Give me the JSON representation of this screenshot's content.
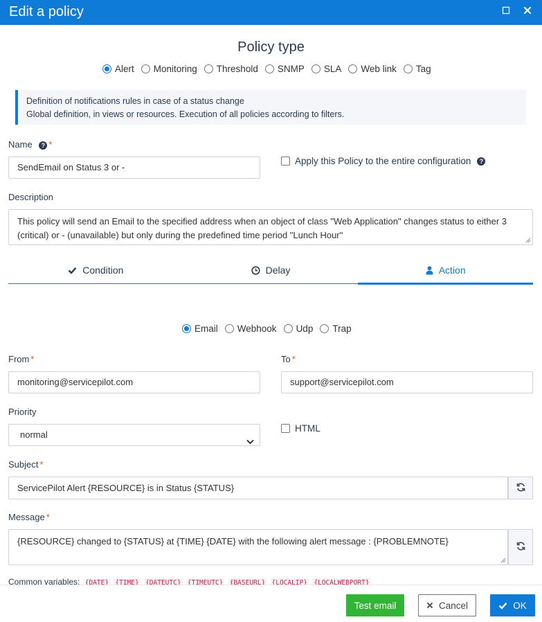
{
  "dialog": {
    "title": "Edit a policy"
  },
  "policy_type": {
    "heading": "Policy type",
    "options": [
      {
        "label": "Alert",
        "checked": true
      },
      {
        "label": "Monitoring",
        "checked": false
      },
      {
        "label": "Threshold",
        "checked": false
      },
      {
        "label": "SNMP",
        "checked": false
      },
      {
        "label": "SLA",
        "checked": false
      },
      {
        "label": "Web link",
        "checked": false
      },
      {
        "label": "Tag",
        "checked": false
      }
    ]
  },
  "info": {
    "line1": "Definition of notifications rules in case of a status change",
    "line2": "Global definition, in views or resources. Execution of all policies according to filters."
  },
  "name": {
    "label": "Name",
    "required": "*",
    "help": "?",
    "value": "SendEmail on Status 3 or -"
  },
  "apply_all": {
    "label": "Apply this Policy to the entire configuration",
    "help": "?",
    "checked": false
  },
  "description": {
    "label": "Description",
    "value": "This policy will send an Email to the specified address when an object of class \"Web Application\" changes status to either 3 (critical) or - (unavailable) but only during the predefined time period \"Lunch Hour\""
  },
  "tabs": [
    {
      "label": "Condition",
      "icon": "check-icon",
      "active": false
    },
    {
      "label": "Delay",
      "icon": "clock-icon",
      "active": false
    },
    {
      "label": "Action",
      "icon": "user-icon",
      "active": true
    }
  ],
  "action_type": {
    "options": [
      {
        "label": "Email",
        "checked": true
      },
      {
        "label": "Webhook",
        "checked": false
      },
      {
        "label": "Udp",
        "checked": false
      },
      {
        "label": "Trap",
        "checked": false
      }
    ]
  },
  "from": {
    "label": "From",
    "required": "*",
    "value": "monitoring@servicepilot.com"
  },
  "to": {
    "label": "To",
    "required": "*",
    "value": "support@servicepilot.com"
  },
  "priority": {
    "label": "Priority",
    "value": "normal"
  },
  "html": {
    "label": "HTML",
    "checked": false
  },
  "subject": {
    "label": "Subject",
    "required": "*",
    "value": "ServicePilot Alert {RESOURCE} is in Status {STATUS}"
  },
  "message": {
    "label": "Message",
    "required": "*",
    "value": "{RESOURCE} changed to {STATUS} at {TIME} {DATE} with the following alert message : {PROBLEMNOTE}"
  },
  "common_variables": {
    "label": "Common variables:",
    "items": [
      "{DATE}",
      "{TIME}",
      "{DATEUTC}",
      "{TIMEUTC}",
      "{BASEURL}",
      "{LOCALIP}",
      "{LOCALWEBPORT}"
    ]
  },
  "footer": {
    "test_label": "Test email",
    "cancel_label": "Cancel",
    "ok_label": "OK"
  },
  "colors": {
    "primary": "#0d7bd7",
    "success": "#30b534",
    "required": "#e8541d",
    "heading": "#2a3b52"
  }
}
